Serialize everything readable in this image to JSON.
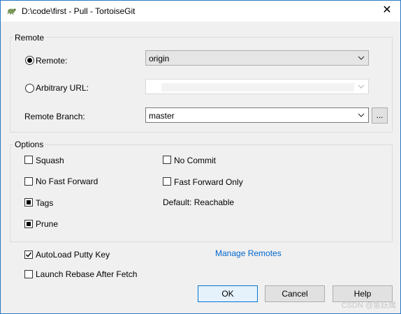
{
  "window": {
    "title": "D:\\code\\first - Pull - TortoiseGit",
    "close_glyph": "✕"
  },
  "remote_group": {
    "label": "Remote",
    "remote_radio_label": "Remote:",
    "remote_selected": true,
    "remote_value": "origin",
    "arbitrary_radio_label": "Arbitrary URL:",
    "arbitrary_selected": false,
    "arbitrary_value": "",
    "remote_branch_label": "Remote Branch:",
    "remote_branch_value": "master",
    "browse_button_label": "..."
  },
  "options_group": {
    "label": "Options",
    "squash_label": "Squash",
    "no_fast_forward_label": "No Fast Forward",
    "tags_label": "Tags",
    "prune_label": "Prune",
    "no_commit_label": "No Commit",
    "fast_forward_only_label": "Fast Forward Only",
    "default_text": "Default: Reachable"
  },
  "bottom": {
    "autoload_putty_label": "AutoLoad Putty Key",
    "autoload_checked": true,
    "launch_rebase_label": "Launch Rebase After Fetch",
    "launch_rebase_checked": false,
    "manage_remotes_link": "Manage Remotes"
  },
  "buttons": {
    "ok": "OK",
    "cancel": "Cancel",
    "help": "Help"
  },
  "watermark": "CSDN @鱼跃鹰"
}
